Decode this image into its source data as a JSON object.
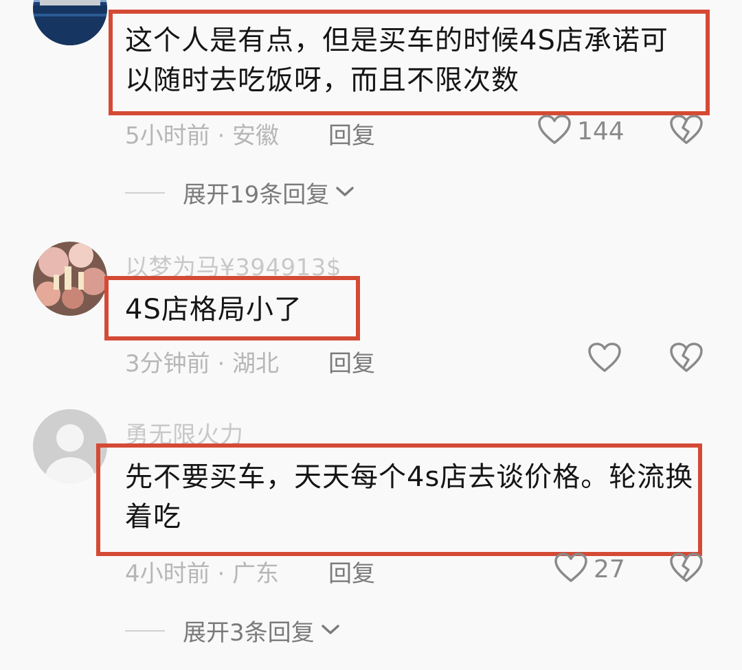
{
  "comments": [
    {
      "username": "",
      "text": "这个人是有点，但是买车的时候4S店承诺可以随时去吃饭呀，而且不限次数",
      "time_location": "5小时前 · 安徽",
      "reply_label": "回复",
      "like_count": "144",
      "expand_label": "展开19条回复"
    },
    {
      "username": "以梦为马¥394913$",
      "text": "4S店格局小了",
      "time_location": "3分钟前 · 湖北",
      "reply_label": "回复",
      "like_count": "",
      "expand_label": ""
    },
    {
      "username": "勇无限火力",
      "text": "先不要买车，天天每个4s店去谈价格。轮流换着吃",
      "time_location": "4小时前 · 广东",
      "reply_label": "回复",
      "like_count": "27",
      "expand_label": "展开3条回复"
    }
  ],
  "icons": {
    "like": "heart-outline-icon",
    "dislike": "broken-heart-icon",
    "expand": "chevron-down-icon"
  },
  "colors": {
    "highlight_border": "#d44a35",
    "username": "#c8c8c8",
    "meta": "#b6b6b6",
    "action": "#7a7a7a"
  }
}
